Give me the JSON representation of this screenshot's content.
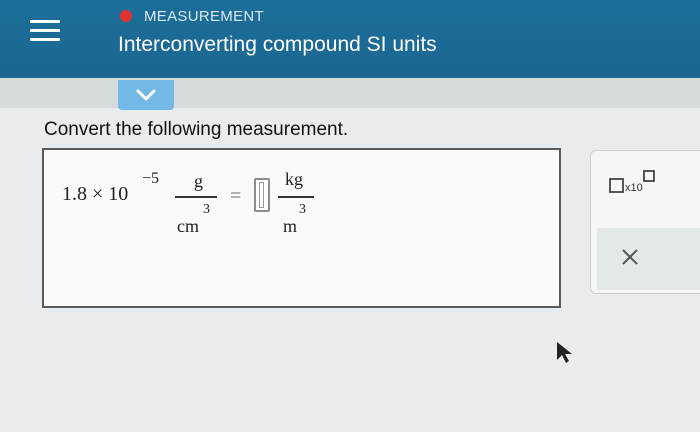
{
  "header": {
    "topic": "MEASUREMENT",
    "title": "Interconverting compound SI units",
    "color": "#1d6e9a",
    "topic_dot_color": "#e0332f"
  },
  "question": {
    "prompt": "Convert the following measurement."
  },
  "expression": {
    "coefficient": "1.8 × 10",
    "exponent": "−5",
    "left_unit_numerator": "g",
    "left_unit_denominator": "cm",
    "left_unit_denominator_power": "3",
    "equals": "=",
    "right_unit_numerator": "kg",
    "right_unit_denominator": "m",
    "right_unit_denominator_power": "3"
  },
  "tools": {
    "x10_label": "x10",
    "clear_icon": "close-icon"
  }
}
